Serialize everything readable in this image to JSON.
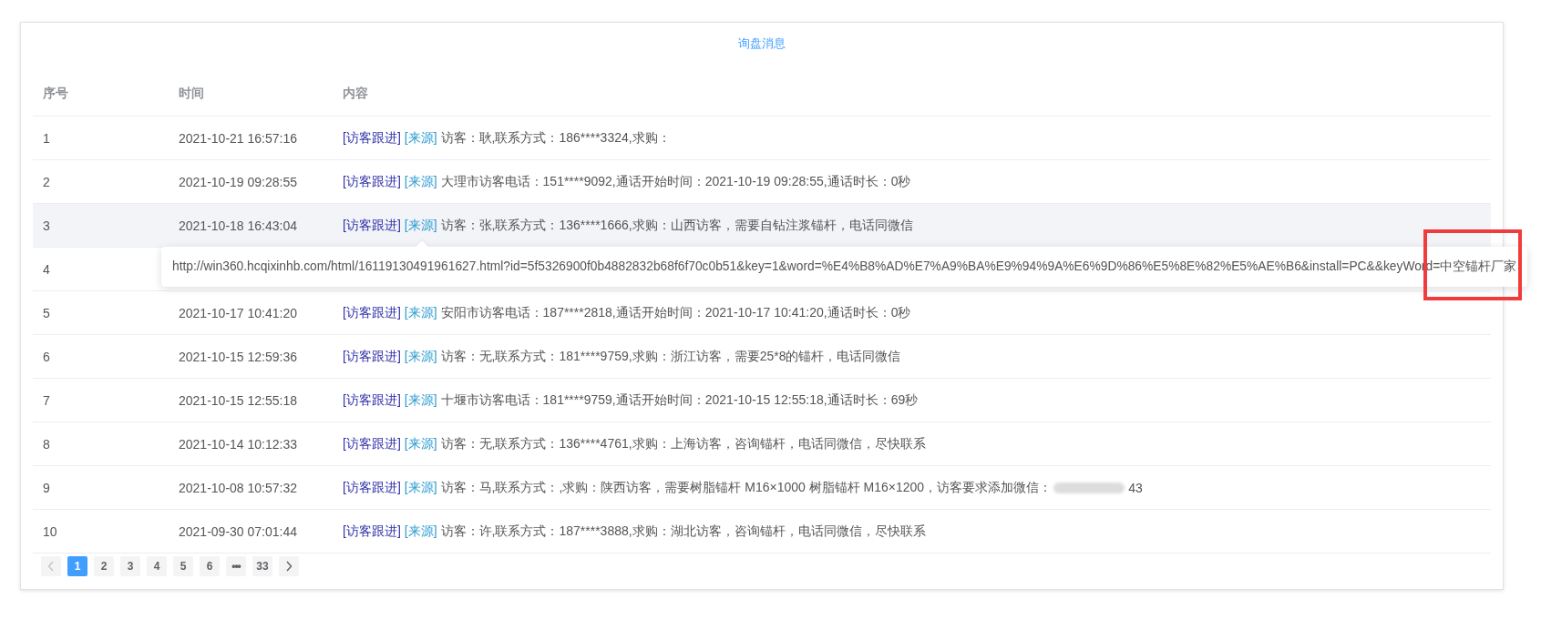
{
  "title": "询盘消息",
  "table": {
    "columns": [
      "序号",
      "时间",
      "内容"
    ],
    "rows": [
      {
        "index": "1",
        "time": "2021-10-21 16:57:16",
        "follow": "[访客跟进]",
        "source": "[来源]",
        "text": "访客：耿,联系方式：186****3324,求购：",
        "hovered": false
      },
      {
        "index": "2",
        "time": "2021-10-19 09:28:55",
        "follow": "[访客跟进]",
        "source": "[来源]",
        "text": "大理市访客电话：151****9092,通话开始时间：2021-10-19 09:28:55,通话时长：0秒",
        "hovered": false
      },
      {
        "index": "3",
        "time": "2021-10-18 16:43:04",
        "follow": "[访客跟进]",
        "source": "[来源]",
        "text": "访客：张,联系方式：136****1666,求购：山西访客，需要自钻注浆锚杆，电话同微信",
        "hovered": true
      },
      {
        "index": "4",
        "hovered": false
      },
      {
        "index": "5",
        "time": "2021-10-17 10:41:20",
        "follow": "[访客跟进]",
        "source": "[来源]",
        "text": "安阳市访客电话：187****2818,通话开始时间：2021-10-17 10:41:20,通话时长：0秒",
        "hovered": false
      },
      {
        "index": "6",
        "time": "2021-10-15 12:59:36",
        "follow": "[访客跟进]",
        "source": "[来源]",
        "text": "访客：无,联系方式：181****9759,求购：浙江访客，需要25*8的锚杆，电话同微信",
        "hovered": false
      },
      {
        "index": "7",
        "time": "2021-10-15 12:55:18",
        "follow": "[访客跟进]",
        "source": "[来源]",
        "text": "十堰市访客电话：181****9759,通话开始时间：2021-10-15 12:55:18,通话时长：69秒",
        "hovered": false
      },
      {
        "index": "8",
        "time": "2021-10-14 10:12:33",
        "follow": "[访客跟进]",
        "source": "[来源]",
        "text": "访客：无,联系方式：136****4761,求购：上海访客，咨询锚杆，电话同微信，尽快联系",
        "hovered": false
      },
      {
        "index": "9",
        "time": "2021-10-08 10:57:32",
        "follow": "[访客跟进]",
        "source": "[来源]",
        "text": "访客：马,联系方式：,求购：陕西访客，需要树脂锚杆 M16×1000 树脂锚杆 M16×1200，访客要求添加微信：",
        "after_redaction": "43",
        "hovered": false
      },
      {
        "index": "10",
        "time": "2021-09-30 07:01:44",
        "follow": "[访客跟进]",
        "source": "[来源]",
        "text": "访客：许,联系方式：187****3888,求购：湖北访客，咨询锚杆，电话同微信，尽快联系",
        "hovered": false
      }
    ]
  },
  "tooltip": "http://win360.hcqixinhb.com/html/16119130491961627.html?id=5f5326900f0b4882832b68f6f70c0b51&key=1&word=%E4%B8%AD%E7%A9%BA%E9%94%9A%E6%9D%86%E5%8E%82%E5%AE%B6&install=PC&&keyWord=中空锚杆厂家",
  "pagination": {
    "prev_disabled": true,
    "next_disabled": false,
    "items": [
      {
        "kind": "page",
        "label": "1",
        "selected": true
      },
      {
        "kind": "page",
        "label": "2",
        "selected": false
      },
      {
        "kind": "page",
        "label": "3",
        "selected": false
      },
      {
        "kind": "page",
        "label": "4",
        "selected": false
      },
      {
        "kind": "page",
        "label": "5",
        "selected": false
      },
      {
        "kind": "page",
        "label": "6",
        "selected": false
      },
      {
        "kind": "ellipsis",
        "label": "•••",
        "selected": false
      },
      {
        "kind": "page",
        "label": "33",
        "selected": false
      }
    ]
  }
}
